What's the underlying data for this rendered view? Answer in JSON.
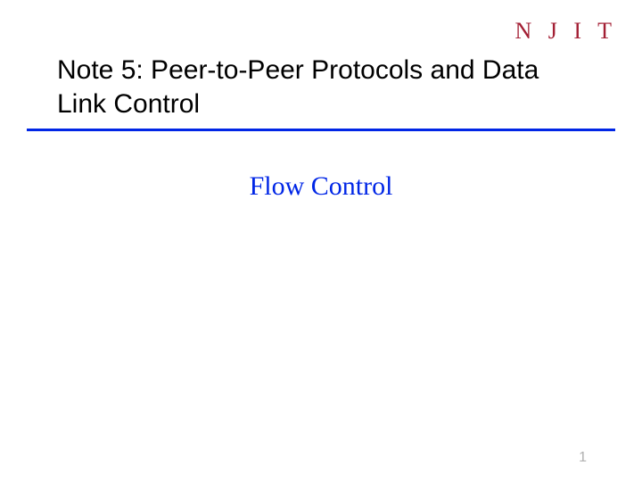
{
  "logo": "N J I T",
  "title": "Note 5: Peer-to-Peer Protocols and Data Link Control",
  "subtitle": "Flow Control",
  "pageNumber": "1"
}
